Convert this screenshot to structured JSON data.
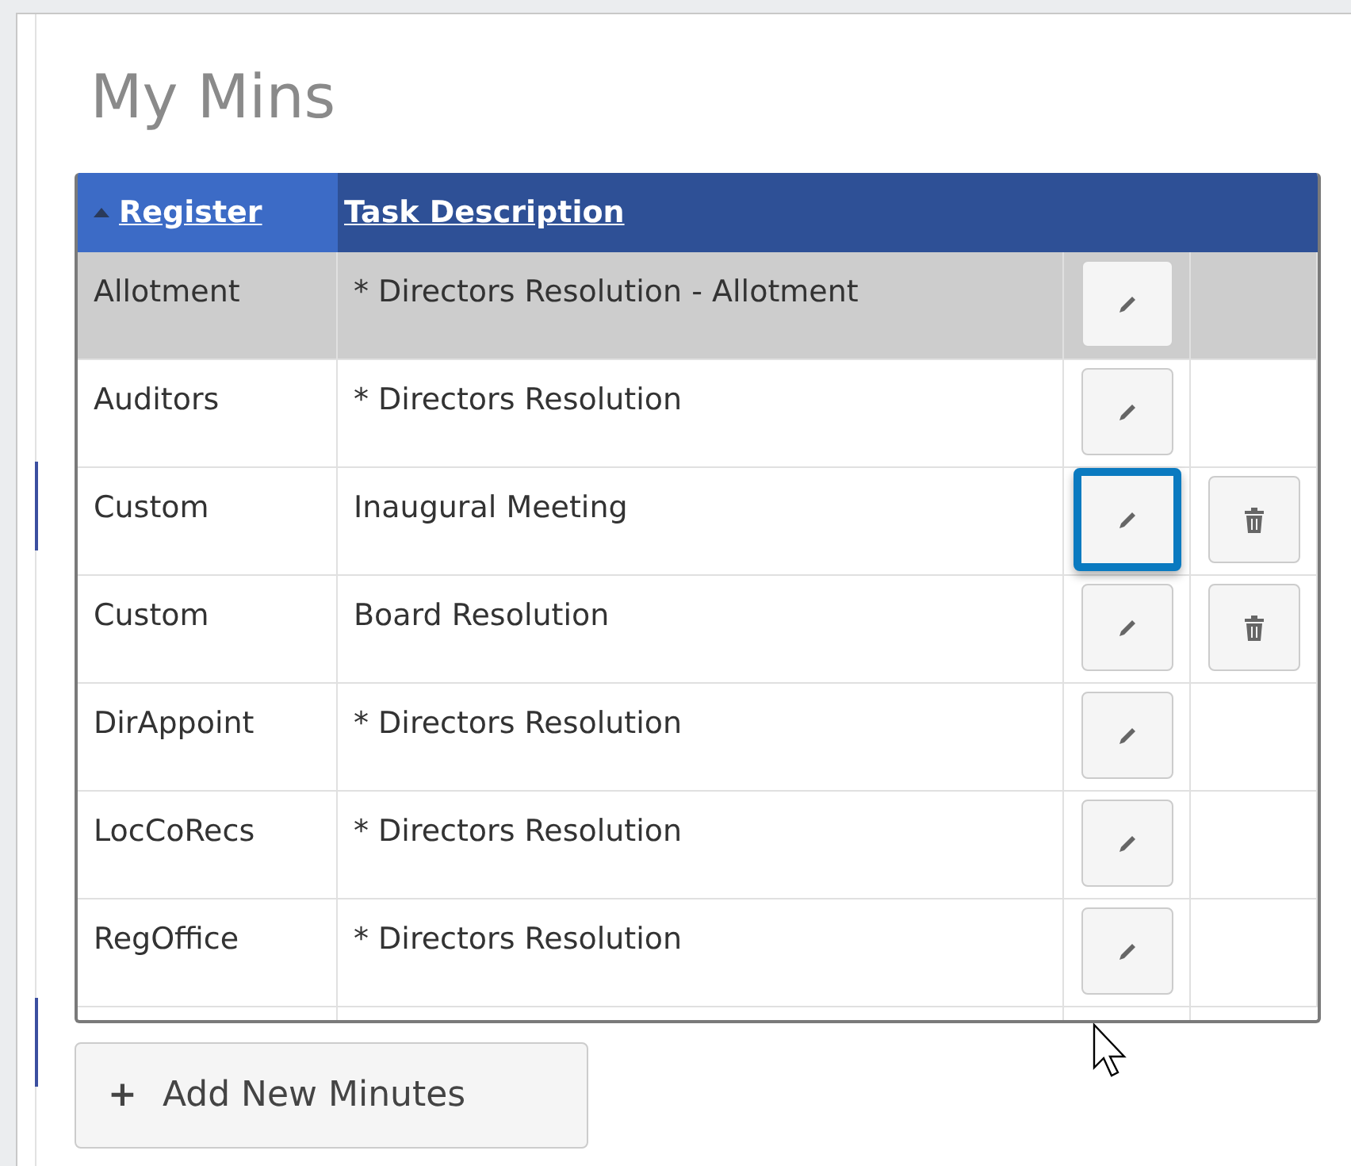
{
  "title": "My Mins",
  "table": {
    "columns": [
      {
        "label": "Register",
        "sorted": true
      },
      {
        "label": "Task Description",
        "sorted": false
      }
    ],
    "rows": [
      {
        "register": "Allotment",
        "task": "* Directors Resolution - Allotment",
        "selected": true,
        "deletable": false,
        "edit_focused": false
      },
      {
        "register": "Auditors",
        "task": "* Directors Resolution",
        "selected": false,
        "deletable": false,
        "edit_focused": false
      },
      {
        "register": "Custom",
        "task": "Inaugural Meeting",
        "selected": false,
        "deletable": true,
        "edit_focused": true
      },
      {
        "register": "Custom",
        "task": "Board Resolution",
        "selected": false,
        "deletable": true,
        "edit_focused": false
      },
      {
        "register": "DirAppoint",
        "task": "* Directors Resolution",
        "selected": false,
        "deletable": false,
        "edit_focused": false
      },
      {
        "register": "LocCoRecs",
        "task": "* Directors Resolution",
        "selected": false,
        "deletable": false,
        "edit_focused": false
      },
      {
        "register": "RegOffice",
        "task": "* Directors Resolution",
        "selected": false,
        "deletable": false,
        "edit_focused": false
      }
    ]
  },
  "add_button": {
    "icon": "+",
    "label": "Add New Minutes"
  }
}
